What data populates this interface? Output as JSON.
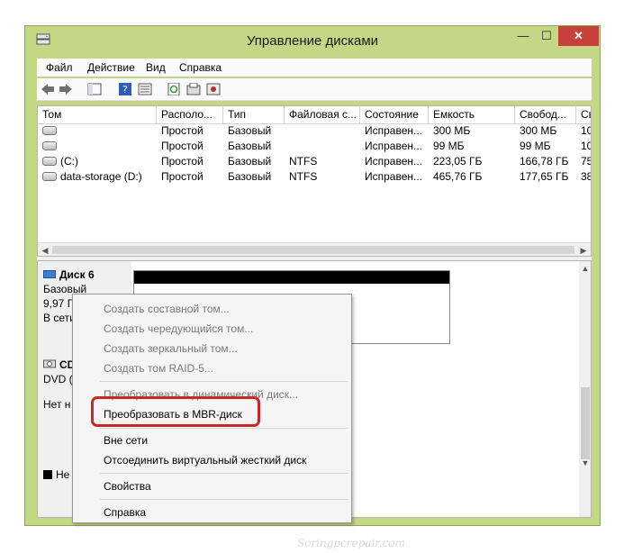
{
  "window": {
    "title": "Управление дисками"
  },
  "menu": [
    "Файл",
    "Действие",
    "Вид",
    "Справка"
  ],
  "columns": [
    "Том",
    "Располо...",
    "Тип",
    "Файловая с...",
    "Состояние",
    "Емкость",
    "Свобод...",
    "Св"
  ],
  "volumes": [
    {
      "name": "",
      "layout": "Простой",
      "type": "Базовый",
      "fs": "",
      "status": "Исправен...",
      "capacity": "300 МБ",
      "free": "300 МБ",
      "pct": "10("
    },
    {
      "name": "",
      "layout": "Простой",
      "type": "Базовый",
      "fs": "",
      "status": "Исправен...",
      "capacity": "99 МБ",
      "free": "99 МБ",
      "pct": "10("
    },
    {
      "name": "(C:)",
      "layout": "Простой",
      "type": "Базовый",
      "fs": "NTFS",
      "status": "Исправен...",
      "capacity": "223,05 ГБ",
      "free": "166,78 ГБ",
      "pct": "75"
    },
    {
      "name": "data-storage (D:)",
      "layout": "Простой",
      "type": "Базовый",
      "fs": "NTFS",
      "status": "Исправен...",
      "capacity": "465,76 ГБ",
      "free": "177,65 ГБ",
      "pct": "38"
    }
  ],
  "disk6": {
    "name": "Диск 6",
    "type": "Базовый",
    "size": "9,97 Г",
    "status": "В сети"
  },
  "cdrom": {
    "name": "CD",
    "type": "DVD (",
    "status": "Нет н"
  },
  "legend": {
    "text": "Не"
  },
  "context_menu": {
    "items": [
      {
        "label": "Создать составной том...",
        "enabled": false
      },
      {
        "label": "Создать чередующийся том...",
        "enabled": false
      },
      {
        "label": "Создать зеркальный том...",
        "enabled": false
      },
      {
        "label": "Создать том RAID-5...",
        "enabled": false
      },
      {
        "label": "Преобразовать в динамический диск...",
        "enabled": false
      },
      {
        "label": "Преобразовать в MBR-диск",
        "enabled": true
      },
      {
        "label": "Вне сети",
        "enabled": true
      },
      {
        "label": "Отсоединить виртуальный жесткий диск",
        "enabled": true
      },
      {
        "label": "Свойства",
        "enabled": true
      },
      {
        "label": "Справка",
        "enabled": true
      }
    ]
  },
  "watermark": "Soringpcrepair.com",
  "colors": {
    "window_frame": "#c4d784",
    "close_button": "#c7403a",
    "highlight": "#cc2727"
  }
}
